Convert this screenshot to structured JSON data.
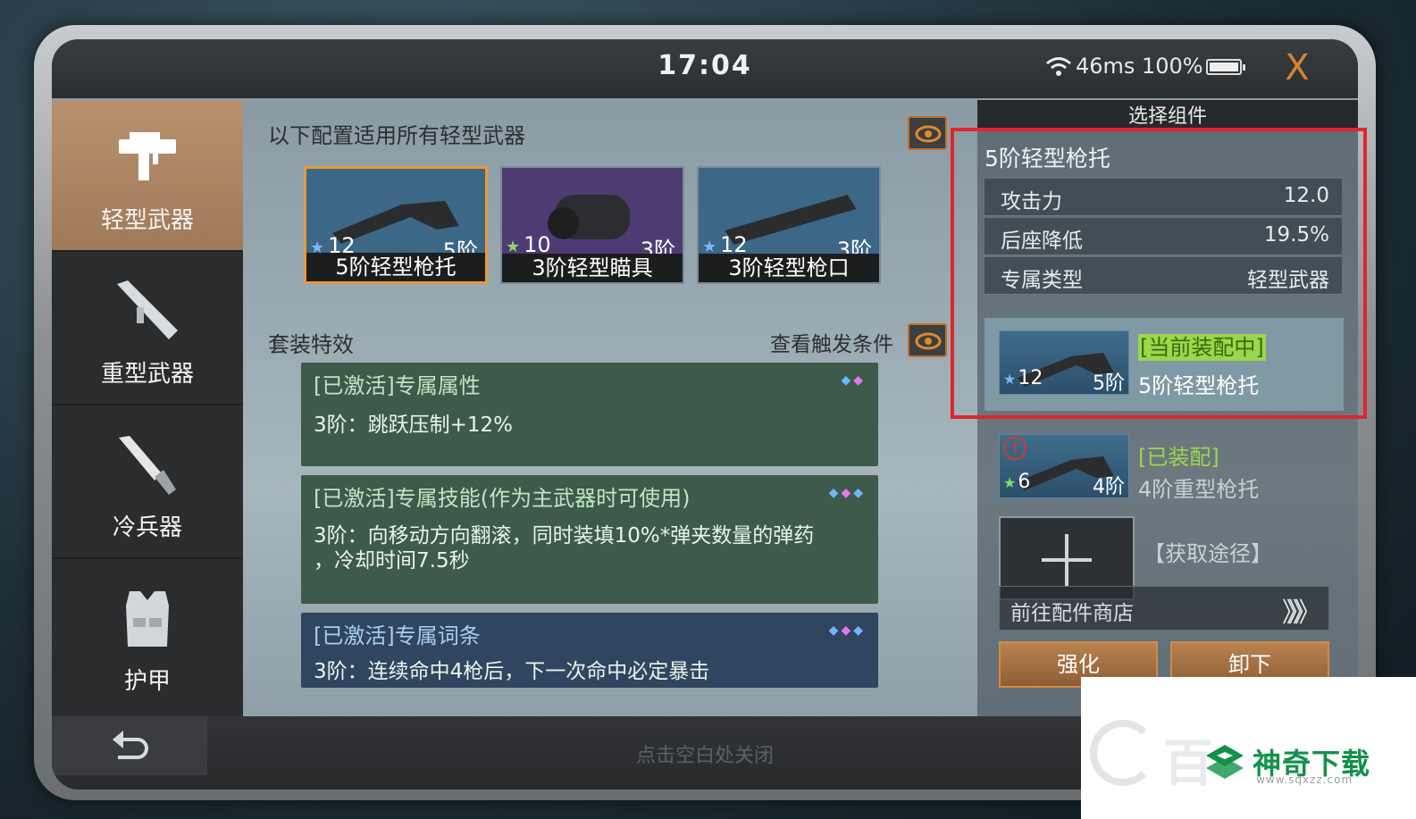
{
  "status": {
    "time": "17:04",
    "ping": "46ms",
    "battery": "100%",
    "close_glyph": "X"
  },
  "sidebar": {
    "items": [
      {
        "label": "轻型武器",
        "icon": "smg-icon"
      },
      {
        "label": "重型武器",
        "icon": "launcher-icon"
      },
      {
        "label": "冷兵器",
        "icon": "knife-icon"
      },
      {
        "label": "护甲",
        "icon": "vest-icon"
      }
    ]
  },
  "config": {
    "title": "以下配置适用所有轻型武器",
    "cards": [
      {
        "stars": "12",
        "tier": "5阶",
        "name": "5阶轻型枪托"
      },
      {
        "stars": "10",
        "tier": "3阶",
        "name": "3阶轻型瞄具"
      },
      {
        "stars": "12",
        "tier": "3阶",
        "name": "3阶轻型枪口"
      }
    ]
  },
  "set": {
    "title": "套装特效",
    "view_conditions": "查看触发条件",
    "panels": [
      {
        "title": "[已激活]专属属性",
        "body": "3阶：跳跃压制+12%"
      },
      {
        "title": "[已激活]专属技能(作为主武器时可使用)",
        "body_line1": "3阶：向移动方向翻滚，同时装填10%*弹夹数量的弹药",
        "body_line2": "，冷却时间7.5秒"
      },
      {
        "title": "[已激活]专属词条",
        "body": "3阶：连续命中4枪后，下一次命中必定暴击"
      }
    ]
  },
  "right": {
    "header": "选择组件",
    "item_name": "5阶轻型枪托",
    "stats": [
      {
        "k": "攻击力",
        "v": "12.0"
      },
      {
        "k": "后座降低",
        "v": "19.5%"
      },
      {
        "k": "专属类型",
        "v": "轻型武器"
      }
    ],
    "current": {
      "tag": "[当前装配中]",
      "name": "5阶轻型枪托",
      "stars": "12",
      "tier": "5阶"
    },
    "equipped": {
      "tag": "[已装配]",
      "name": "4阶重型枪托",
      "stars": "6",
      "tier": "4阶",
      "warn": "!"
    },
    "source": "【获取途径】",
    "shop": "前往配件商店",
    "shop_arrow": "》》》",
    "enhance": "强化",
    "unequip": "卸下"
  },
  "bottom": {
    "hint": "点击空白处关闭"
  },
  "watermark": {
    "text": "神奇下载",
    "url": "www.sqxzz.com",
    "bg_text": "百"
  },
  "colors": {
    "accent": "#e89a3c",
    "highlight": "#e0252b",
    "panel_green": "#3e5a4a",
    "panel_blue": "#2f4560"
  }
}
